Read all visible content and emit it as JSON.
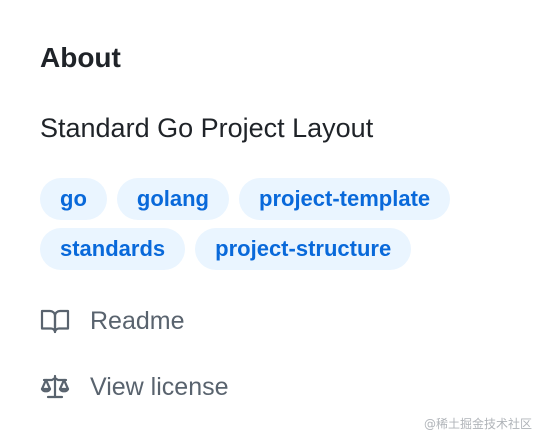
{
  "about": {
    "heading": "About",
    "description": "Standard Go Project Layout",
    "topics": [
      "go",
      "golang",
      "project-template",
      "standards",
      "project-structure"
    ],
    "links": {
      "readme": {
        "icon": "book-icon",
        "label": "Readme"
      },
      "license": {
        "icon": "law-scale-icon",
        "label": "View license"
      }
    }
  },
  "colors": {
    "topic_background": "#eaf5ff",
    "topic_text": "#0969da",
    "heading_text": "#1f2328",
    "muted_text": "#59636e"
  },
  "watermark": "@稀土掘金技术社区"
}
